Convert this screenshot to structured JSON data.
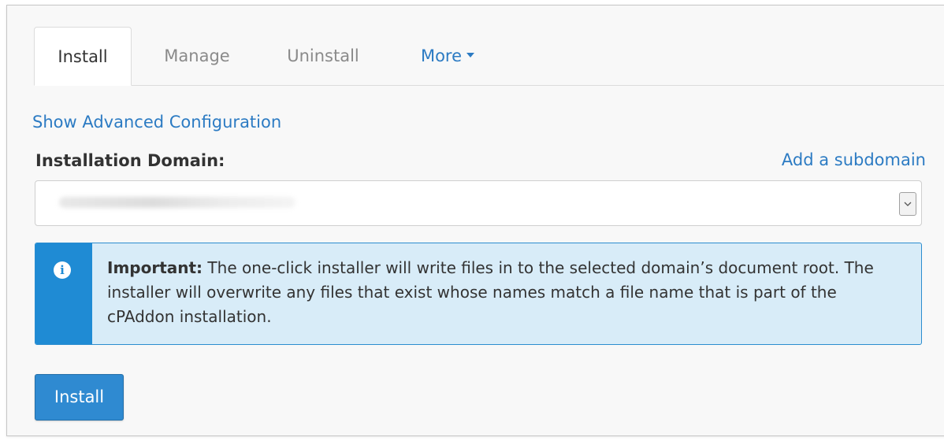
{
  "tabs": {
    "install": "Install",
    "manage": "Manage",
    "uninstall": "Uninstall",
    "more": "More"
  },
  "links": {
    "advanced": "Show Advanced Configuration",
    "add_subdomain": "Add a subdomain"
  },
  "form": {
    "domain_label": "Installation Domain:",
    "domain_value": "",
    "domain_value_blurred": true
  },
  "alert": {
    "icon": "info-icon",
    "strong": "Important:",
    "message": " The one-click installer will write files in to the selected domain’s document root. The installer will overwrite any files that exist whose names match a file name that is part of the cPAddon installation."
  },
  "actions": {
    "install_button": "Install"
  },
  "colors": {
    "accent": "#2c7bc3",
    "alert_bg": "#d8ecf8",
    "alert_accent": "#1f8bd4",
    "button": "#2f8ad1"
  }
}
